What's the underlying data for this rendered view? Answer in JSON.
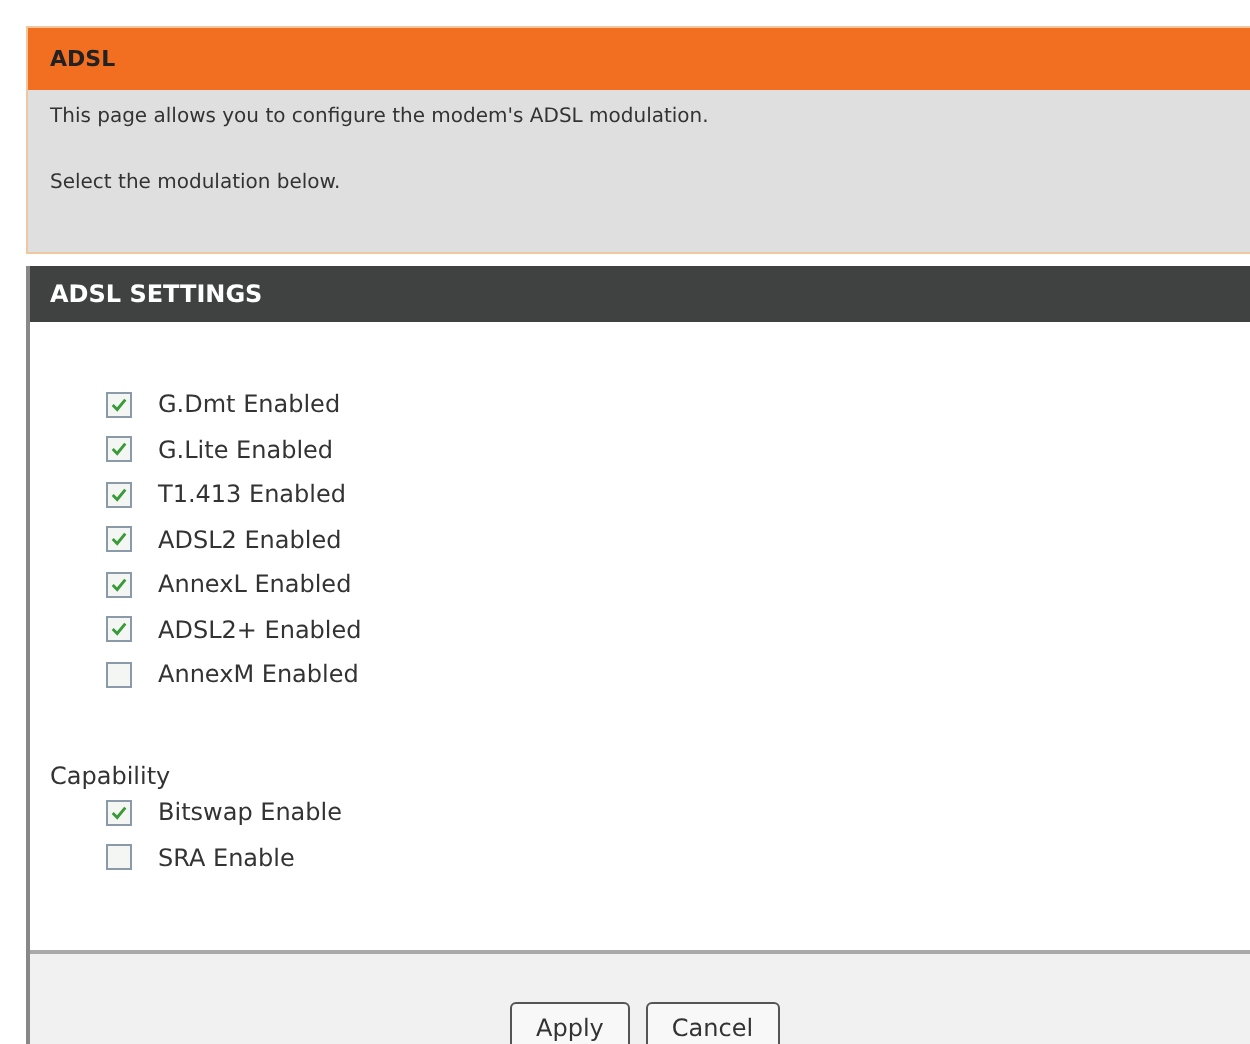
{
  "info_panel": {
    "title": "ADSL",
    "lines": [
      "This page allows you to configure the modem's ADSL modulation.",
      "Select the modulation below."
    ]
  },
  "settings": {
    "title": "ADSL SETTINGS",
    "modulations": [
      {
        "label": "G.Dmt Enabled",
        "checked": true
      },
      {
        "label": "G.Lite Enabled",
        "checked": true
      },
      {
        "label": "T1.413 Enabled",
        "checked": true
      },
      {
        "label": "ADSL2 Enabled",
        "checked": true
      },
      {
        "label": "AnnexL Enabled",
        "checked": true
      },
      {
        "label": "ADSL2+ Enabled",
        "checked": true
      },
      {
        "label": "AnnexM Enabled",
        "checked": false
      }
    ],
    "capability_label": "Capability",
    "capabilities": [
      {
        "label": "Bitswap Enable",
        "checked": true
      },
      {
        "label": "SRA Enable",
        "checked": false
      }
    ]
  },
  "buttons": [
    "Apply",
    "Cancel"
  ]
}
